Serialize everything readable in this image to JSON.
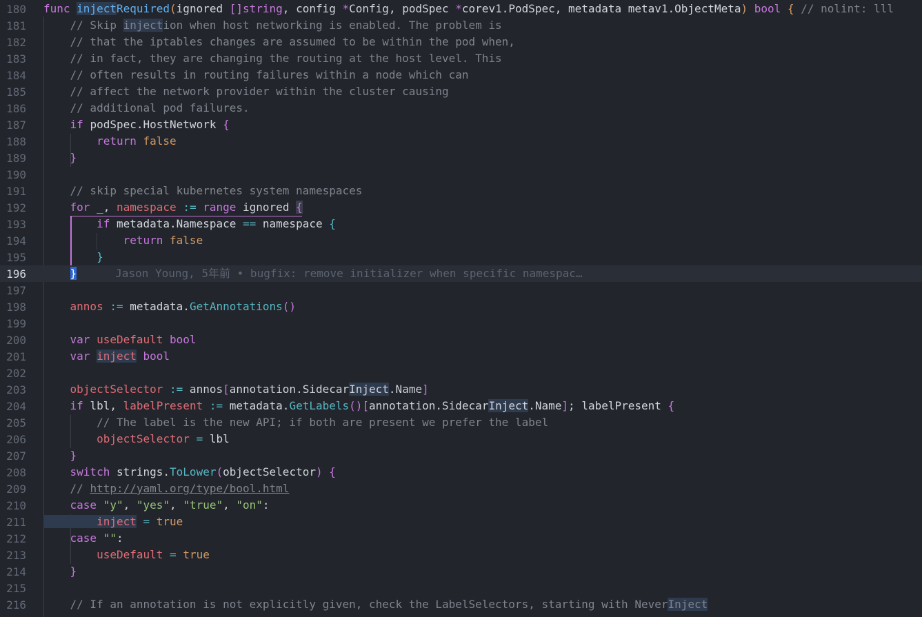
{
  "editor": {
    "current_line": 196,
    "blame": "Jason Young, 5年前 • bugfix: remove initializer when specific namespac…"
  },
  "lines": [
    {
      "n": "180",
      "tokens": [
        [
          "k",
          "func "
        ],
        [
          "fy hl",
          "inject"
        ],
        [
          "fy",
          "Required"
        ],
        [
          "n",
          "("
        ],
        [
          "p",
          "ignored "
        ],
        [
          "k",
          "[]"
        ],
        [
          "t",
          "string"
        ],
        [
          "p",
          ", config "
        ],
        [
          "k",
          "*"
        ],
        [
          "p",
          "Config, podSpec "
        ],
        [
          "k",
          "*"
        ],
        [
          "p",
          "corev1.PodSpec, metadata metav1.ObjectMeta"
        ],
        [
          "n",
          ")"
        ],
        [
          "p",
          " "
        ],
        [
          "t",
          "bool"
        ],
        [
          "p",
          " "
        ],
        [
          "n",
          "{"
        ],
        [
          "c",
          " // nolint: lll"
        ]
      ]
    },
    {
      "n": "181",
      "tokens": [
        [
          "c",
          "    // Skip "
        ],
        [
          "c hl",
          "inject"
        ],
        [
          "c",
          "ion when host networking is enabled. The problem is"
        ]
      ]
    },
    {
      "n": "182",
      "tokens": [
        [
          "c",
          "    // that the iptables changes are assumed to be within the pod when,"
        ]
      ]
    },
    {
      "n": "183",
      "tokens": [
        [
          "c",
          "    // in fact, they are changing the routing at the host level. This"
        ]
      ]
    },
    {
      "n": "184",
      "tokens": [
        [
          "c",
          "    // often results in routing failures within a node which can"
        ]
      ]
    },
    {
      "n": "185",
      "tokens": [
        [
          "c",
          "    // affect the network provider within the cluster causing"
        ]
      ]
    },
    {
      "n": "186",
      "tokens": [
        [
          "c",
          "    // additional pod failures."
        ]
      ]
    },
    {
      "n": "187",
      "tokens": [
        [
          "k",
          "    if "
        ],
        [
          "p",
          "podSpec.HostNetwork "
        ],
        [
          "k",
          "{"
        ]
      ]
    },
    {
      "n": "188",
      "tokens": [
        [
          "k",
          "        return "
        ],
        [
          "n",
          "false"
        ]
      ]
    },
    {
      "n": "189",
      "tokens": [
        [
          "k",
          "    }"
        ]
      ]
    },
    {
      "n": "190",
      "tokens": []
    },
    {
      "n": "191",
      "tokens": [
        [
          "c",
          "    // skip special kubernetes system namespaces"
        ]
      ]
    },
    {
      "n": "192",
      "tokens": [
        [
          "k",
          "    for "
        ],
        [
          "p",
          "_, "
        ],
        [
          "v",
          "namespace"
        ],
        [
          "p",
          " "
        ],
        [
          "f",
          ":="
        ],
        [
          "p",
          " "
        ],
        [
          "k",
          "range "
        ],
        [
          "p",
          "ignored "
        ],
        [
          "k hl2",
          "{"
        ]
      ]
    },
    {
      "n": "193",
      "tokens": [
        [
          "k",
          "        if "
        ],
        [
          "p",
          "metadata.Namespace "
        ],
        [
          "f",
          "=="
        ],
        [
          "p",
          " namespace "
        ],
        [
          "f",
          "{"
        ]
      ]
    },
    {
      "n": "194",
      "tokens": [
        [
          "k",
          "            return "
        ],
        [
          "n",
          "false"
        ]
      ]
    },
    {
      "n": "195",
      "tokens": [
        [
          "f",
          "        }"
        ]
      ]
    },
    {
      "n": "196",
      "tokens": [
        [
          "p",
          "    "
        ],
        [
          "cursor",
          "}"
        ]
      ]
    },
    {
      "n": "197",
      "tokens": []
    },
    {
      "n": "198",
      "tokens": [
        [
          "v",
          "    annos"
        ],
        [
          "p",
          " "
        ],
        [
          "f",
          ":="
        ],
        [
          "p",
          " metadata."
        ],
        [
          "f",
          "GetAnnotations"
        ],
        [
          "k",
          "()"
        ]
      ]
    },
    {
      "n": "199",
      "tokens": []
    },
    {
      "n": "200",
      "tokens": [
        [
          "k",
          "    var "
        ],
        [
          "v",
          "useDefault"
        ],
        [
          "p",
          " "
        ],
        [
          "t",
          "bool"
        ]
      ]
    },
    {
      "n": "201",
      "tokens": [
        [
          "k",
          "    var "
        ],
        [
          "v hl",
          "inject"
        ],
        [
          "p",
          " "
        ],
        [
          "t",
          "bool"
        ]
      ]
    },
    {
      "n": "202",
      "tokens": []
    },
    {
      "n": "203",
      "tokens": [
        [
          "v",
          "    objectSelector"
        ],
        [
          "p",
          " "
        ],
        [
          "f",
          ":="
        ],
        [
          "p",
          " annos"
        ],
        [
          "k",
          "["
        ],
        [
          "p",
          "annotation.Sidecar"
        ],
        [
          "p hl",
          "Inject"
        ],
        [
          "p",
          ".Name"
        ],
        [
          "k",
          "]"
        ]
      ]
    },
    {
      "n": "204",
      "tokens": [
        [
          "k",
          "    if "
        ],
        [
          "p",
          "lbl, "
        ],
        [
          "v",
          "labelPresent"
        ],
        [
          "p",
          " "
        ],
        [
          "f",
          ":="
        ],
        [
          "p",
          " metadata."
        ],
        [
          "f",
          "GetLabels"
        ],
        [
          "k",
          "()["
        ],
        [
          "p",
          "annotation.Sidecar"
        ],
        [
          "p hl",
          "Inject"
        ],
        [
          "p",
          ".Name"
        ],
        [
          "k",
          "]"
        ],
        [
          "p",
          "; labelPresent "
        ],
        [
          "k",
          "{"
        ]
      ]
    },
    {
      "n": "205",
      "tokens": [
        [
          "c",
          "        // The label is the new API; if both are present we prefer the label"
        ]
      ]
    },
    {
      "n": "206",
      "tokens": [
        [
          "v",
          "        objectSelector"
        ],
        [
          "p",
          " "
        ],
        [
          "f",
          "="
        ],
        [
          "p",
          " lbl"
        ]
      ]
    },
    {
      "n": "207",
      "tokens": [
        [
          "k",
          "    }"
        ]
      ]
    },
    {
      "n": "208",
      "tokens": [
        [
          "k",
          "    switch "
        ],
        [
          "p",
          "strings."
        ],
        [
          "f",
          "ToLower"
        ],
        [
          "k",
          "("
        ],
        [
          "p",
          "objectSelector"
        ],
        [
          "k",
          ")"
        ],
        [
          "p",
          " "
        ],
        [
          "k",
          "{"
        ]
      ]
    },
    {
      "n": "209",
      "tokens": [
        [
          "c",
          "    // "
        ],
        [
          "link",
          "http://yaml.org/type/bool.html"
        ]
      ]
    },
    {
      "n": "210",
      "tokens": [
        [
          "k",
          "    case "
        ],
        [
          "s",
          "\"y\""
        ],
        [
          "p",
          ", "
        ],
        [
          "s",
          "\"yes\""
        ],
        [
          "p",
          ", "
        ],
        [
          "s",
          "\"true\""
        ],
        [
          "p",
          ", "
        ],
        [
          "s",
          "\"on\""
        ],
        [
          "p",
          ":"
        ]
      ]
    },
    {
      "n": "211",
      "tokens": [
        [
          "v hl",
          "        inject"
        ],
        [
          "p",
          " "
        ],
        [
          "f",
          "="
        ],
        [
          "p",
          " "
        ],
        [
          "n",
          "true"
        ]
      ]
    },
    {
      "n": "212",
      "tokens": [
        [
          "k",
          "    case "
        ],
        [
          "s",
          "\"\""
        ],
        [
          "p",
          ":"
        ]
      ]
    },
    {
      "n": "213",
      "tokens": [
        [
          "v",
          "        useDefault"
        ],
        [
          "p",
          " "
        ],
        [
          "f",
          "="
        ],
        [
          "p",
          " "
        ],
        [
          "n",
          "true"
        ]
      ]
    },
    {
      "n": "214",
      "tokens": [
        [
          "k",
          "    }"
        ]
      ]
    },
    {
      "n": "215",
      "tokens": []
    },
    {
      "n": "216",
      "tokens": [
        [
          "c",
          "    // If an annotation is not explicitly given, check the LabelSelectors, starting with Never"
        ],
        [
          "c hl",
          "Inject"
        ]
      ]
    }
  ]
}
